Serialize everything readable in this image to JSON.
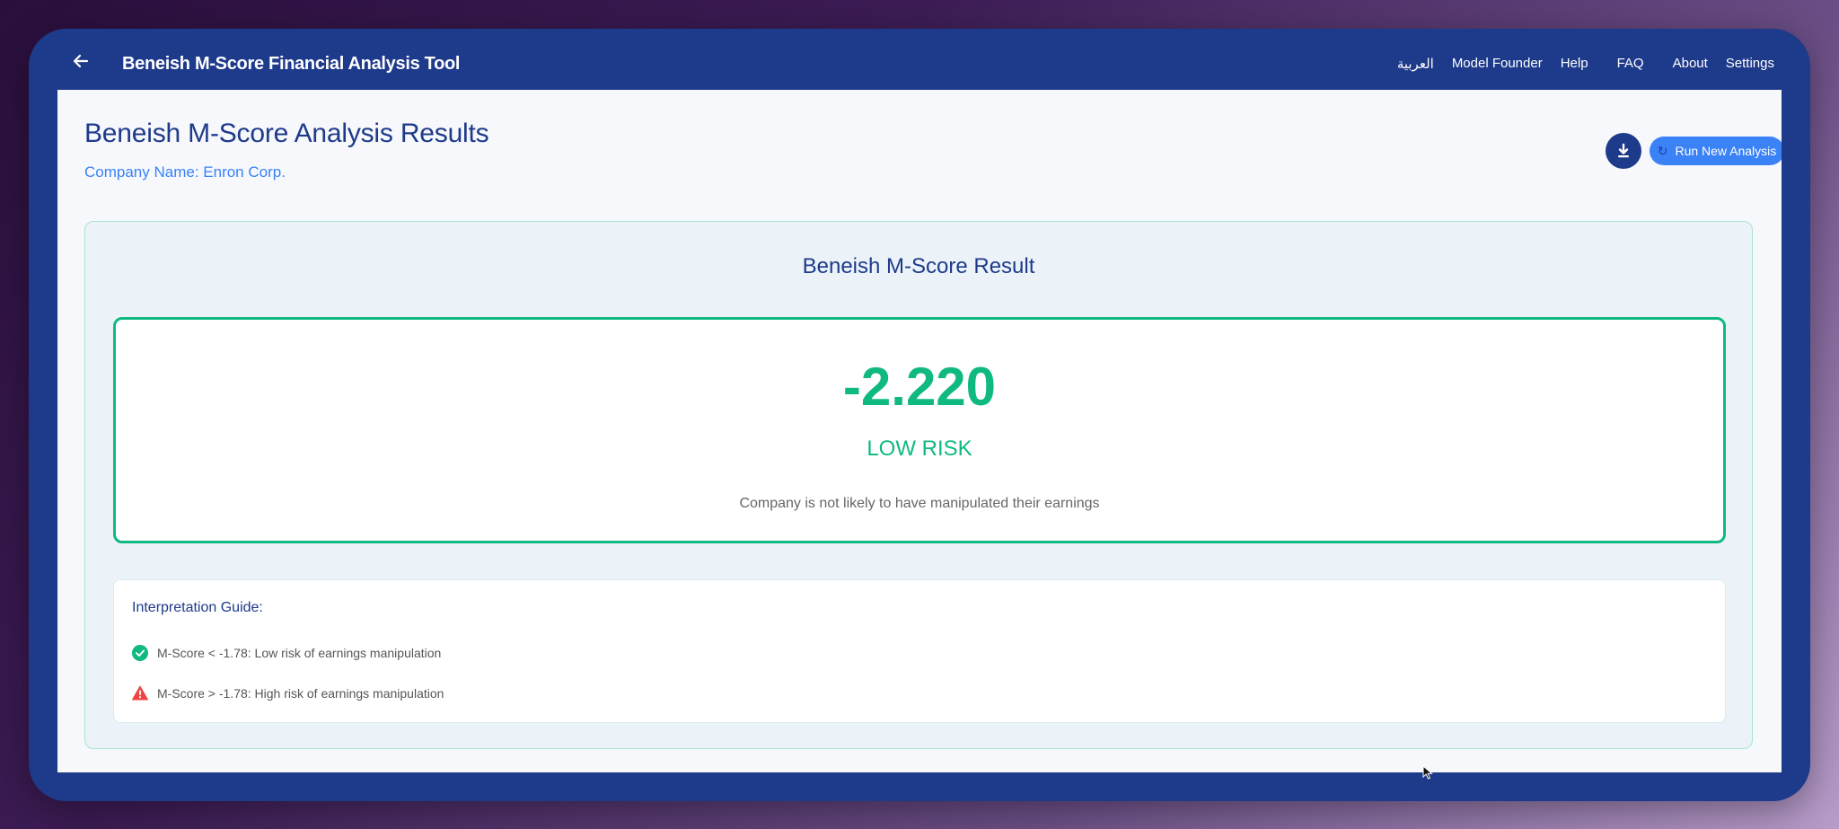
{
  "header": {
    "title": "Beneish M-Score Financial Analysis Tool",
    "back_icon": "arrow-left-icon",
    "nav": [
      {
        "label": "العربية"
      },
      {
        "label": "Model Founder"
      },
      {
        "label": "Help"
      },
      {
        "label": "FAQ"
      },
      {
        "label": "About"
      },
      {
        "label": "Settings"
      }
    ]
  },
  "page": {
    "title": "Beneish M-Score Analysis Results",
    "company_line": "Company Name: Enron Corp.",
    "download_icon": "download-icon",
    "run_button_label": "Run New Analysis",
    "run_button_icon": "refresh-icon"
  },
  "result": {
    "heading": "Beneish M-Score Result",
    "score": "-2.220",
    "risk_label": "LOW RISK",
    "description": "Company is not likely to have manipulated their earnings"
  },
  "guide": {
    "title": "Interpretation Guide:",
    "items": [
      {
        "icon": "check-circle-icon",
        "text": "M-Score < -1.78: Low risk of earnings manipulation"
      },
      {
        "icon": "warning-triangle-icon",
        "text": "M-Score > -1.78: High risk of earnings manipulation"
      }
    ]
  },
  "colors": {
    "header_bg": "#1e3a8a",
    "accent_blue": "#3b82f6",
    "low_risk_green": "#10b981",
    "warning_red": "#ef4444"
  }
}
